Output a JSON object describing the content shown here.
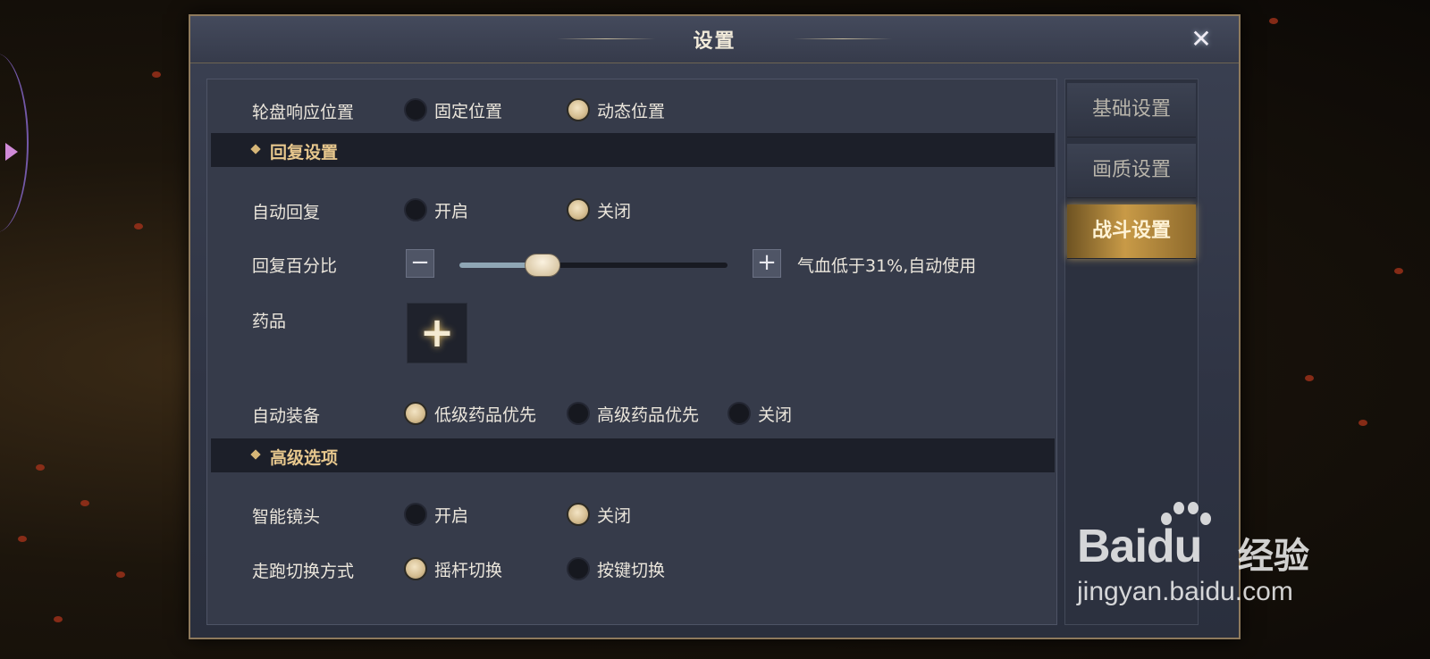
{
  "dialog": {
    "title": "设置",
    "close_icon": "close-x-icon"
  },
  "wheel_position": {
    "label": "轮盘响应位置",
    "options": [
      {
        "label": "固定位置",
        "selected": false
      },
      {
        "label": "动态位置",
        "selected": true
      }
    ]
  },
  "recovery_section": {
    "title": "回复设置"
  },
  "auto_recover": {
    "label": "自动回复",
    "options": [
      {
        "label": "开启",
        "selected": false
      },
      {
        "label": "关闭",
        "selected": true
      }
    ]
  },
  "recover_percent": {
    "label": "回复百分比",
    "value": 31,
    "description": "气血低于31%,自动使用"
  },
  "medicine": {
    "label": "药品"
  },
  "auto_equip": {
    "label": "自动装备",
    "options": [
      {
        "label": "低级药品优先",
        "selected": true
      },
      {
        "label": "高级药品优先",
        "selected": false
      },
      {
        "label": "关闭",
        "selected": false
      }
    ]
  },
  "advanced_section": {
    "title": "高级选项"
  },
  "smart_camera": {
    "label": "智能镜头",
    "options": [
      {
        "label": "开启",
        "selected": false
      },
      {
        "label": "关闭",
        "selected": true
      }
    ]
  },
  "run_switch": {
    "label": "走跑切换方式",
    "options": [
      {
        "label": "摇杆切换",
        "selected": true
      },
      {
        "label": "按键切换",
        "selected": false
      }
    ]
  },
  "tabs": [
    {
      "label": "基础设置",
      "active": false
    },
    {
      "label": "画质设置",
      "active": false
    },
    {
      "label": "战斗设置",
      "active": true
    }
  ],
  "watermark": {
    "logo_text": "Bai",
    "logo_du": "du",
    "jingyan": "经验",
    "url": "jingyan.baidu.com"
  },
  "colors": {
    "accent_gold": "#e7c78d",
    "active_tab": "#c89a47",
    "panel_bg": "#363b4a"
  }
}
